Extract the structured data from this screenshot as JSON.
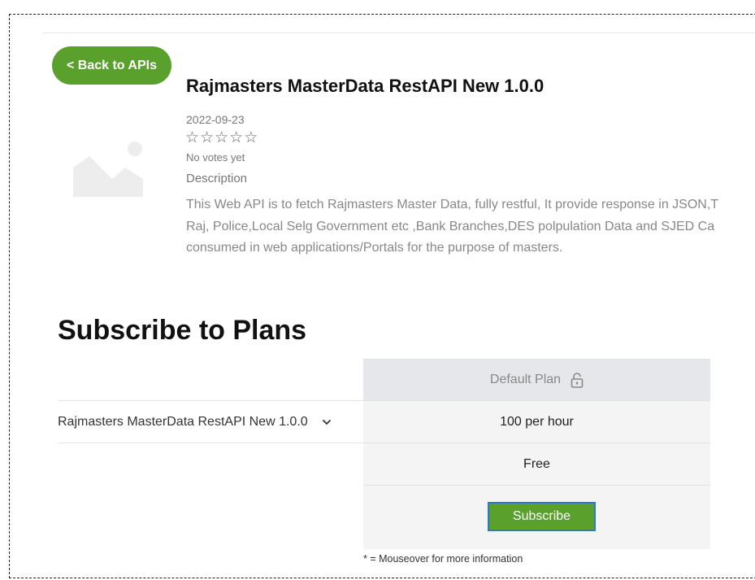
{
  "navigation": {
    "back_label": "< Back to APIs"
  },
  "api": {
    "title": "Rajmasters MasterData RestAPI New 1.0.0",
    "date": "2022-09-23",
    "rating": {
      "stars": 5,
      "filled": 0,
      "votes_text": "No votes yet"
    },
    "description_label": "Description",
    "description_lines": [
      "This Web API is to fetch Rajmasters Master Data, fully restful, It provide response in JSON,T",
      "Raj, Police,Local Selg Government etc ,Bank Branches,DES polpulation Data and SJED Ca",
      "consumed in web applications/Portals for the purpose of masters."
    ]
  },
  "plans": {
    "title": "Subscribe to Plans",
    "plan_name": "Default Plan",
    "api_select_value": "Rajmasters MasterData RestAPI New 1.0.0",
    "rate_limit": "100 per hour",
    "price": "Free",
    "subscribe_label": "Subscribe",
    "note": "* = Mouseover for more information"
  }
}
